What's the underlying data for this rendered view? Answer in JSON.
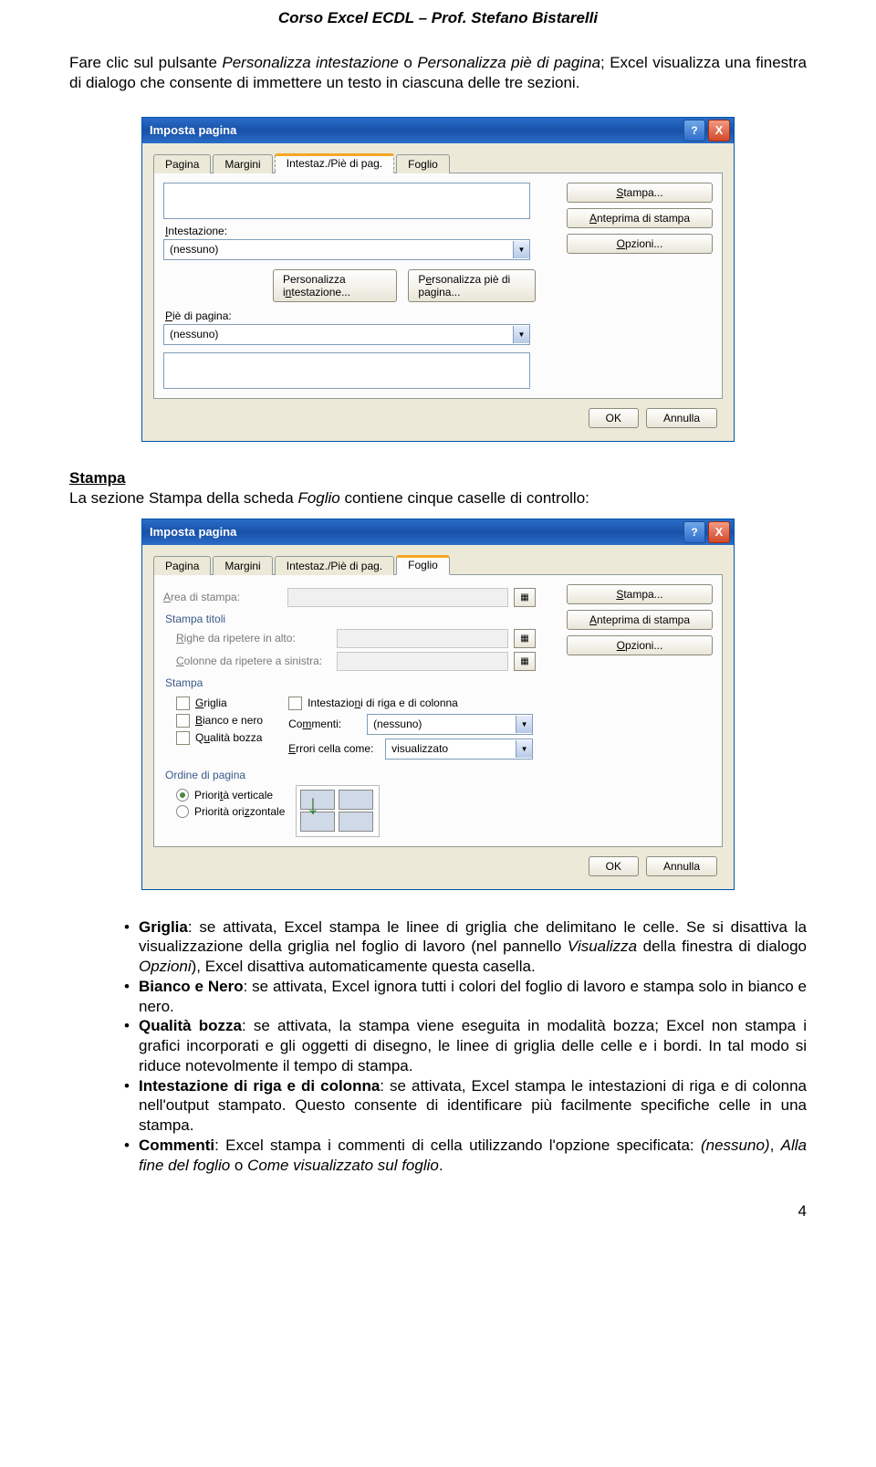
{
  "header": "Corso Excel ECDL – Prof. Stefano Bistarelli",
  "intro": {
    "pre": "Fare clic sul pulsante ",
    "em1": "Personalizza intestazione",
    "mid1": " o ",
    "em2": "Personalizza piè di pagina",
    "post": "; Excel visualizza una finestra di dialogo che consente di immettere un testo in ciascuna delle tre sezioni."
  },
  "dlg1": {
    "title": "Imposta pagina",
    "help": "?",
    "close": "X",
    "tabs": {
      "pagina": "Pagina",
      "margini": "Margini",
      "intestaz": "Intestaz./Piè di pag.",
      "foglio": "Foglio"
    },
    "btn_stampa": "Stampa...",
    "btn_anteprima": "Anteprima di stampa",
    "btn_opzioni": "Opzioni...",
    "lbl_intestazione": "Intestazione:",
    "val_intestazione": "(nessuno)",
    "btn_persint": "Personalizza intestazione...",
    "btn_perspie": "Personalizza piè di pagina...",
    "lbl_pie": "Piè di pagina:",
    "val_pie": "(nessuno)",
    "ok": "OK",
    "annulla": "Annulla"
  },
  "section": {
    "title": "Stampa",
    "intro_a": "La sezione Stampa della scheda ",
    "intro_em": "Foglio",
    "intro_b": " contiene cinque caselle di controllo:"
  },
  "dlg2": {
    "title": "Imposta pagina",
    "help": "?",
    "close": "X",
    "tabs": {
      "pagina": "Pagina",
      "margini": "Margini",
      "intestaz": "Intestaz./Piè di pag.",
      "foglio": "Foglio"
    },
    "btn_stampa": "Stampa...",
    "btn_anteprima": "Anteprima di stampa",
    "btn_opzioni": "Opzioni...",
    "lbl_area": "Area di stampa:",
    "grp_titoli": "Stampa titoli",
    "lbl_righe": "Righe da ripetere in alto:",
    "lbl_col": "Colonne da ripetere a sinistra:",
    "grp_stampa": "Stampa",
    "chk_griglia": "Griglia",
    "chk_bn": "Bianco e nero",
    "chk_qb": "Qualità bozza",
    "chk_int": "Intestazioni di riga e di colonna",
    "lbl_commenti": "Commenti:",
    "val_commenti": "(nessuno)",
    "lbl_errori": "Errori cella come:",
    "val_errori": "visualizzato",
    "grp_ordine": "Ordine di pagina",
    "rad_vert": "Priorità verticale",
    "rad_oriz": "Priorità orizzontale",
    "ok": "OK",
    "annulla": "Annulla"
  },
  "bullets": {
    "b1_a": "Griglia",
    "b1_b": ": se attivata, Excel stampa le linee di griglia che delimitano le celle. Se si disattiva la visualizzazione della griglia nel foglio di lavoro (nel pannello ",
    "b1_em1": "Visualizza",
    "b1_c": " della finestra di dialogo ",
    "b1_em2": "Opzioni",
    "b1_d": "), Excel disattiva automaticamente questa casella.",
    "b2_a": "Bianco e Nero",
    "b2_b": ": se attivata, Excel ignora tutti i colori del foglio di lavoro e stampa solo in bianco e nero.",
    "b3_a": "Qualità bozza",
    "b3_b": ": se attivata, la stampa viene eseguita in modalità bozza; Excel non stampa i grafici incorporati e gli oggetti di disegno, le linee di griglia delle celle e i bordi. In tal modo si riduce notevolmente il tempo di stampa.",
    "b4_a": "Intestazione di riga e di colonna",
    "b4_b": ": se attivata, Excel stampa le intestazioni di riga e di colonna nell'output stampato. Questo consente di identificare più facilmente specifiche celle in una stampa.",
    "b5_a": "Commenti",
    "b5_b": ": Excel stampa i commenti di cella utilizzando l'opzione specificata: ",
    "b5_em1": "(nessuno)",
    "b5_c": ", ",
    "b5_em2": "Alla fine del foglio",
    "b5_d": " o ",
    "b5_em3": "Come visualizzato sul foglio",
    "b5_e": "."
  },
  "pagenum": "4"
}
